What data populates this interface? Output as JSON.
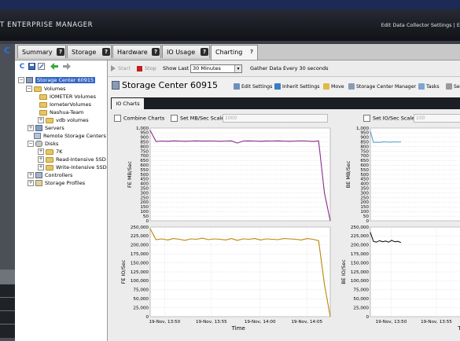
{
  "app": {
    "title": "T ENTERPRISE MANAGER",
    "top_links": "Edit Data Collector Settings | E"
  },
  "tabs": [
    {
      "label": "Summary"
    },
    {
      "label": "Storage"
    },
    {
      "label": "Hardware"
    },
    {
      "label": "IO Usage"
    },
    {
      "label": "Charting"
    }
  ],
  "tree": {
    "items": [
      {
        "label": "Storage Center 60915",
        "level": 0
      },
      {
        "label": "Volumes",
        "level": 1
      },
      {
        "label": "IOMETER Volumes",
        "level": 2
      },
      {
        "label": "IometerVolumes",
        "level": 2
      },
      {
        "label": "Nashua-Team",
        "level": 2
      },
      {
        "label": "vdb volumes",
        "level": 2
      },
      {
        "label": "Servers",
        "level": 1
      },
      {
        "label": "Remote Storage Centers",
        "level": 1
      },
      {
        "label": "Disks",
        "level": 1
      },
      {
        "label": "7K",
        "level": 2
      },
      {
        "label": "Read-Intensive SSD",
        "level": 2
      },
      {
        "label": "Write-Intensive SSD",
        "level": 2
      },
      {
        "label": "Controllers",
        "level": 1
      },
      {
        "label": "Storage Profiles",
        "level": 1
      }
    ]
  },
  "controls": {
    "start": "Start",
    "stop": "Stop",
    "show_last_label": "Show Last",
    "show_last_value": "30 Minutes",
    "gather": "Gather Data Every 30 seconds"
  },
  "header": {
    "title": "Storage Center 60915",
    "actions": [
      "Edit Settings",
      "Inherit Settings",
      "Move",
      "Storage Center Manager",
      "Tasks",
      "Se"
    ]
  },
  "inner_tab": "IO Charts",
  "options": {
    "combine": "Combine Charts",
    "set_mb": "Set MB/Sec Scale",
    "mb_value": "1000",
    "set_io": "Set IO/Sec Scale",
    "io_value": "100"
  },
  "chart_data": [
    {
      "type": "line",
      "ylabel": "FE MB/Sec",
      "ylim": [
        0,
        1000
      ],
      "yticks": [
        "0",
        "50",
        "100",
        "150",
        "200",
        "250",
        "300",
        "350",
        "400",
        "450",
        "500",
        "550",
        "600",
        "650",
        "700",
        "750",
        "800",
        "850",
        "900",
        "950",
        "1,000"
      ],
      "color": "#8b2a8f",
      "x": [
        0,
        1,
        2,
        3,
        4,
        5,
        6,
        7,
        8,
        9,
        10,
        11,
        12,
        13,
        14,
        15,
        16,
        17,
        18,
        19,
        20,
        21,
        22,
        23,
        24,
        25,
        26,
        27,
        28,
        29,
        30,
        31
      ],
      "values": [
        975,
        855,
        860,
        858,
        862,
        860,
        858,
        860,
        862,
        859,
        861,
        860,
        858,
        860,
        862,
        838,
        860,
        862,
        860,
        858,
        861,
        860,
        862,
        860,
        858,
        860,
        862,
        860,
        855,
        862,
        300,
        0
      ]
    },
    {
      "type": "line",
      "ylabel": "BE MB/Sec",
      "yticks": [
        "0",
        "50",
        "100",
        "150",
        "200",
        "250",
        "300",
        "350",
        "400",
        "450",
        "500",
        "550",
        "600",
        "650",
        "700",
        "750",
        "800",
        "850",
        "900",
        "950",
        "1,000"
      ],
      "color": "#5a9fce",
      "values": [
        965,
        845,
        848,
        846,
        850,
        852,
        848,
        850,
        852,
        849,
        851
      ]
    },
    {
      "type": "line",
      "ylabel": "FE IO/Sec",
      "ylim": [
        0,
        250000
      ],
      "yticks": [
        "0",
        "25,000",
        "50,000",
        "75,000",
        "100,000",
        "125,000",
        "150,000",
        "175,000",
        "200,000",
        "225,000",
        "250,000"
      ],
      "color": "#b8860b",
      "xticks": [
        "19-Nov, 13:50",
        "19-Nov, 13:55",
        "19-Nov, 14:00",
        "19-Nov, 14:05"
      ],
      "xlabel": "Time",
      "values": [
        245000,
        215000,
        217000,
        214000,
        218000,
        216000,
        213000,
        217000,
        216000,
        219000,
        215000,
        217000,
        216000,
        214000,
        218000,
        213000,
        217000,
        216000,
        218000,
        214000,
        217000,
        216000,
        215000,
        218000,
        217000,
        216000,
        214000,
        218000,
        216000,
        212000,
        90000,
        0
      ]
    },
    {
      "type": "line",
      "ylabel": "BE IO/Sec",
      "yticks": [
        "0",
        "25,000",
        "50,000",
        "75,000",
        "100,000",
        "125,000",
        "150,000",
        "175,000",
        "200,000",
        "225,000",
        "250,000"
      ],
      "color": "#1a1a1a",
      "xticks": [
        "19-Nov, 13:50",
        "19-Nov, 13:55"
      ],
      "xlabel": "Time",
      "values": [
        235000,
        210000,
        208000,
        212000,
        209000,
        211000,
        208000,
        213000,
        209000,
        210000,
        207000
      ]
    }
  ]
}
